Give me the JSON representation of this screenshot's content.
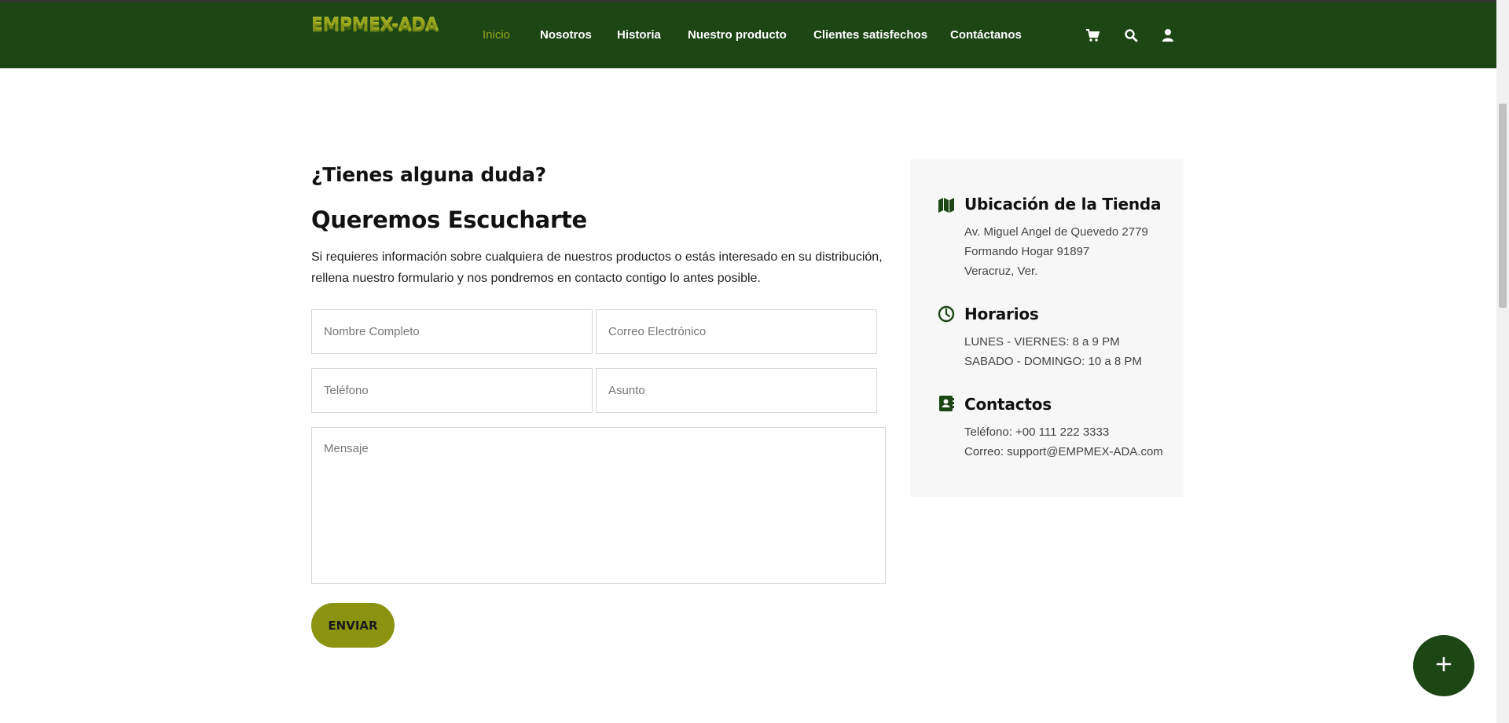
{
  "brand": {
    "logo_text": "EMPMEX-ADA"
  },
  "nav": {
    "items": [
      {
        "label": "Inicio",
        "active": true
      },
      {
        "label": "Nosotros"
      },
      {
        "label": "Historia"
      },
      {
        "label": "Nuestro producto"
      },
      {
        "label": "Clientes satisfechos"
      },
      {
        "label": "Contáctanos"
      }
    ],
    "icons": [
      "cart-icon",
      "search-icon",
      "user-icon"
    ]
  },
  "contact": {
    "question": "¿Tienes alguna duda?",
    "heading": "Queremos Escucharte",
    "intro": "Si requieres información sobre cualquiera de nuestros productos o estás interesado en su distribución, rellena nuestro formulario y nos pondremos en contacto contigo lo antes posible.",
    "form": {
      "name_placeholder": "Nombre Completo",
      "email_placeholder": "Correo Electrónico",
      "phone_placeholder": "Teléfono",
      "subject_placeholder": "Asunto",
      "message_placeholder": "Mensaje",
      "submit_label": "ENVIAR"
    }
  },
  "info": {
    "location": {
      "title": "Ubicación de la Tienda",
      "lines": [
        "Av. Miguel Angel de Quevedo 2779",
        "Formando Hogar 91897",
        "Veracruz, Ver."
      ]
    },
    "hours": {
      "title": "Horarios",
      "lines": [
        "LUNES - VIERNES: 8 a 9 PM",
        "SABADO - DOMINGO: 10 a 8 PM"
      ]
    },
    "contacts": {
      "title": "Contactos",
      "lines": [
        "Teléfono: +00 111 222 3333",
        "Correo: support@EMPMEX-ADA.com"
      ]
    }
  },
  "colors": {
    "brand_green": "#1c4614",
    "accent_olive": "#8a9410",
    "active_nav": "#9aa61b",
    "panel_bg": "#f7f7f7"
  }
}
